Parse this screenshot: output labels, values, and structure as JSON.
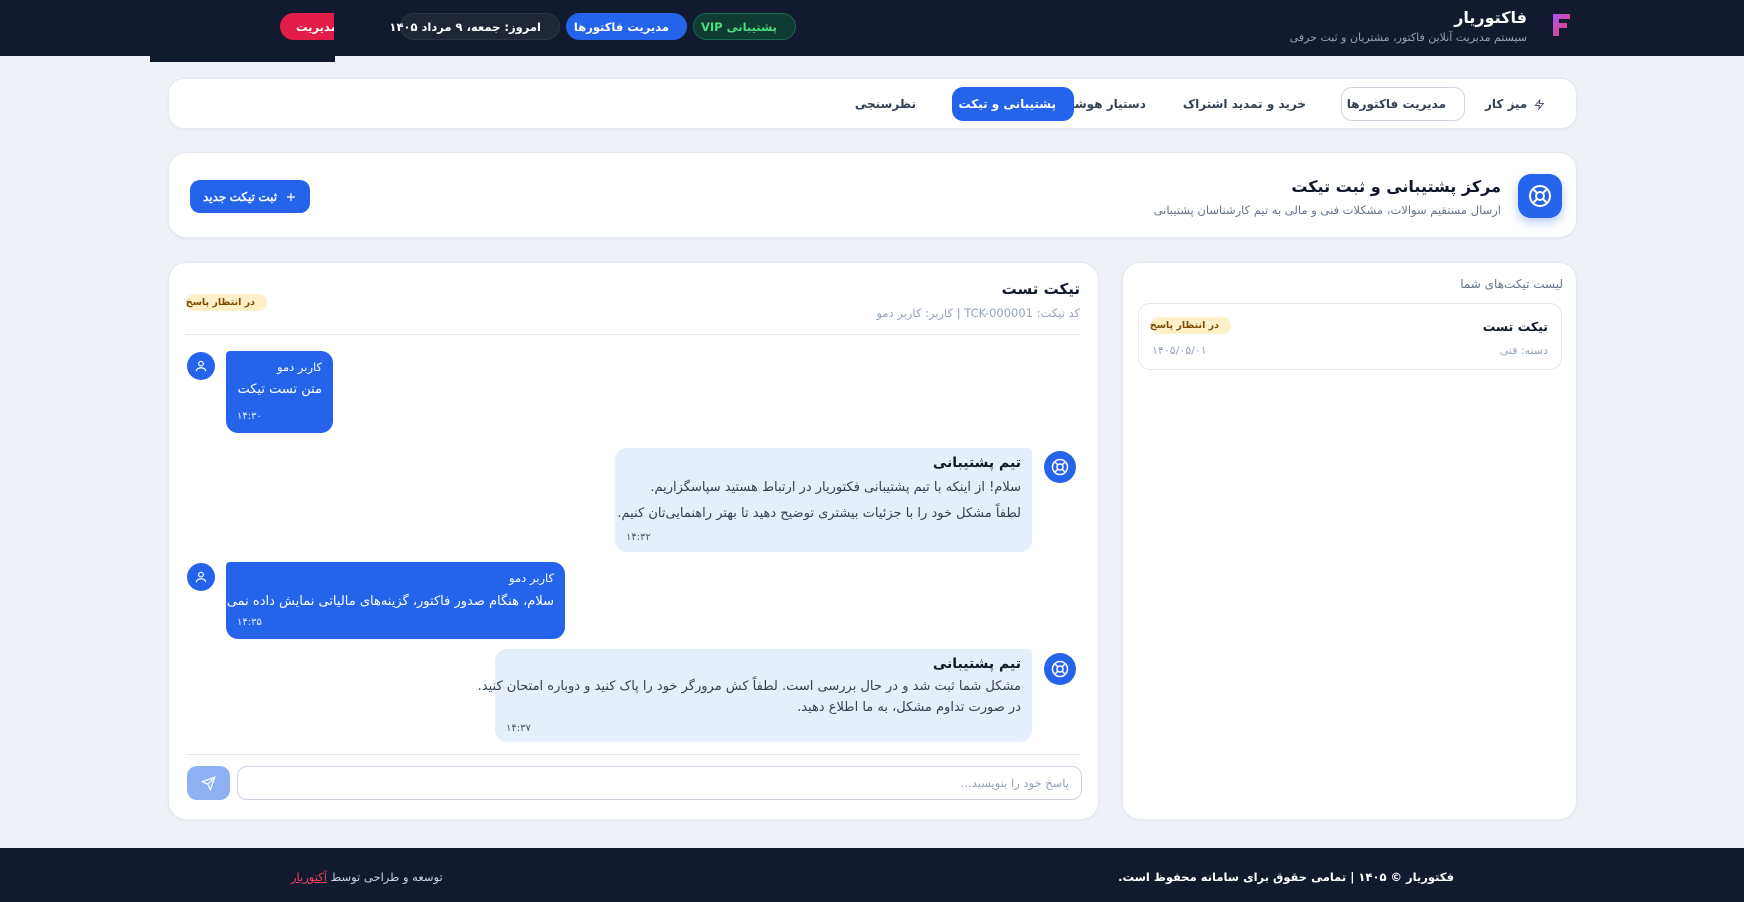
{
  "header": {
    "brand_title": "فاکتوریار",
    "brand_subtitle": "سیستم مدیریت آنلاین فاکتور، مشتریان و ثبت حرفی",
    "vip_label": "پشتیبانی VIP",
    "invoices_label": "مدیریت فاکتورها",
    "date_label": "امروز: جمعه، ۹ مرداد ۱۴۰۵",
    "panel_label": "پنل مدیریت",
    "colors": {
      "bg": "#111a2e",
      "accent": "#2563eb",
      "vip": "#4ade80",
      "danger": "#e11d48"
    }
  },
  "nav": {
    "items": [
      {
        "label": "میز کار",
        "icon": "lightning-icon"
      },
      {
        "label": "مدیریت فاکتورها",
        "icon": "document-icon"
      },
      {
        "label": "خرید و تمدید اشتراک",
        "icon": "crown-icon"
      },
      {
        "label": "دستیار هوشمند",
        "icon": "robot-icon"
      },
      {
        "label": "پشتیبانی و تیکت",
        "icon": "lifebuoy-icon",
        "active": true
      },
      {
        "label": "نظرسنجی",
        "icon": "star-icon"
      }
    ]
  },
  "hero": {
    "title": "مرکز پشتیبانی و ثبت تیکت",
    "subtitle": "ارسال مستقیم سوالات، مشکلات فنی و مالی به تیم کارشناسان پشتیبانی",
    "new_ticket_label": "ثبت تیکت جدید"
  },
  "ticket_list": {
    "title": "لیست تیکت‌های شما",
    "items": [
      {
        "title": "تیکت تست",
        "status": "در انتظار پاسخ",
        "category": "دسته: فنی",
        "date": "۱۴۰۵/۰۵/۰۱"
      }
    ]
  },
  "chat": {
    "title": "تیکت تست",
    "meta": "کد تیکت: TCK-000001 | کاربر: کاربر دمو",
    "status": "در انتظار پاسخ",
    "messages": [
      {
        "sender": "کاربر دمو",
        "text": "متن تست تیکت",
        "time": "۱۴:۳۰"
      },
      {
        "sender": "تیم پشتیبانی",
        "lines": [
          "سلام! از اینکه با تیم پشتیبانی فکتوریار در ارتباط هستید سپاسگزاریم.",
          "لطفاً مشکل خود را با جزئیات بیشتری توضیح دهید تا بهتر راهنمایی‌تان کنیم."
        ],
        "time": "۱۴:۳۲"
      },
      {
        "sender": "کاربر دمو",
        "text": "سلام، هنگام صدور فاکتور، گزینه‌های مالیاتی نمایش داده نمی‌شود.",
        "time": "۱۴:۳۵"
      },
      {
        "sender": "تیم پشتیبانی",
        "lines": [
          "مشکل شما ثبت شد و در حال بررسی است. لطفاً کش مرورگر خود را پاک کنید و دوباره امتحان کنید.",
          "در صورت تداوم مشکل، به ما اطلاع دهید."
        ],
        "time": "۱۴:۳۷"
      }
    ],
    "reply_placeholder": "پاسخ خود را بنویسید..."
  },
  "footer": {
    "copyright": "فکتوریار © ۱۴۰۵ | تمامی حقوق برای سامانه محفوظ است.",
    "dev_prefix": "توسعه و طراحی توسط",
    "dev_link": "آکتوریار"
  }
}
